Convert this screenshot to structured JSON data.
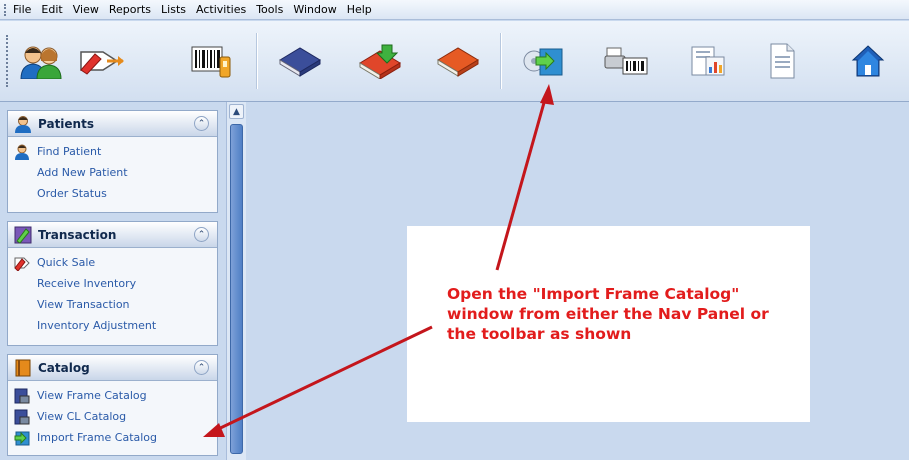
{
  "menu": {
    "items": [
      "File",
      "Edit",
      "View",
      "Reports",
      "Lists",
      "Activities",
      "Tools",
      "Window",
      "Help"
    ]
  },
  "toolbar": {
    "buttons": [
      {
        "icon": "patients-icon"
      },
      {
        "icon": "transaction-pen-icon"
      },
      {
        "icon": "barcode-inventory-icon"
      },
      {
        "icon": "blue-book-icon"
      },
      {
        "icon": "book-download-icon"
      },
      {
        "icon": "orange-book-icon"
      },
      {
        "icon": "import-frame-catalog-icon"
      },
      {
        "icon": "printer-barcode-icon"
      },
      {
        "icon": "report-chart-icon"
      },
      {
        "icon": "document-icon"
      },
      {
        "icon": "home-icon"
      }
    ]
  },
  "nav": {
    "panels": [
      {
        "title": "Patients",
        "links": [
          "Find Patient",
          "Add New Patient",
          "Order Status"
        ]
      },
      {
        "title": "Transaction",
        "links": [
          "Quick Sale",
          "Receive Inventory",
          "View Transaction",
          "Inventory Adjustment"
        ]
      },
      {
        "title": "Catalog",
        "links": [
          "View Frame Catalog",
          "View CL Catalog",
          "Import Frame Catalog"
        ]
      }
    ]
  },
  "callout": {
    "text": "Open the \"Import Frame Catalog\" window from either the Nav Panel or the toolbar as shown"
  },
  "colors": {
    "annotation_red": "#e21c1c",
    "link_blue": "#2a5aa8",
    "app_background": "#c9d9ee"
  }
}
